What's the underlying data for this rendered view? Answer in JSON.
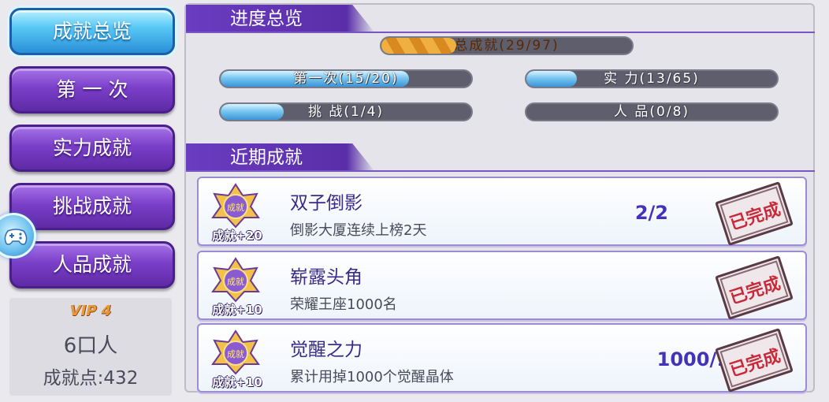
{
  "nav": {
    "items": [
      {
        "label": "成就总览",
        "active": true
      },
      {
        "label": "第 一 次",
        "active": false
      },
      {
        "label": "实力成就",
        "active": false
      },
      {
        "label": "挑战成就",
        "active": false
      },
      {
        "label": "人品成就",
        "active": false
      }
    ]
  },
  "profile": {
    "vip_label": "VIP 4",
    "name": "6口人",
    "points_text": "成就点:432"
  },
  "overview": {
    "title": "进度总览",
    "total": {
      "label": "总成就(29/97)",
      "progress": 0.3
    },
    "bars": [
      {
        "label": "第一次(15/20)",
        "progress": 0.75
      },
      {
        "label": "实 力(13/65)",
        "progress": 0.2
      },
      {
        "label": "挑 战(1/4)",
        "progress": 0.25
      },
      {
        "label": "人 品(0/8)",
        "progress": 0.0
      }
    ]
  },
  "recent": {
    "title": "近期成就",
    "items": [
      {
        "medal_text": "成就",
        "points": "成就+20",
        "title": "双子倒影",
        "desc": "倒影大厦连续上榜2天",
        "progress": "2/2",
        "stamp": "已完成"
      },
      {
        "medal_text": "成就",
        "points": "成就+10",
        "title": "崭露头角",
        "desc": "荣耀王座1000名",
        "progress": "",
        "stamp": "已完成"
      },
      {
        "medal_text": "成就",
        "points": "成就+10",
        "title": "觉醒之力",
        "desc": "累计用掉1000个觉醒晶体",
        "progress": "1000/1000",
        "stamp": "已完成"
      }
    ]
  },
  "colors": {
    "nav_purple": "#7a3fc8",
    "nav_active_blue": "#58c8f5",
    "header_purple": "#5a2ea8",
    "stamp_red": "#c82a3a",
    "progress_text": "#4632b8"
  }
}
